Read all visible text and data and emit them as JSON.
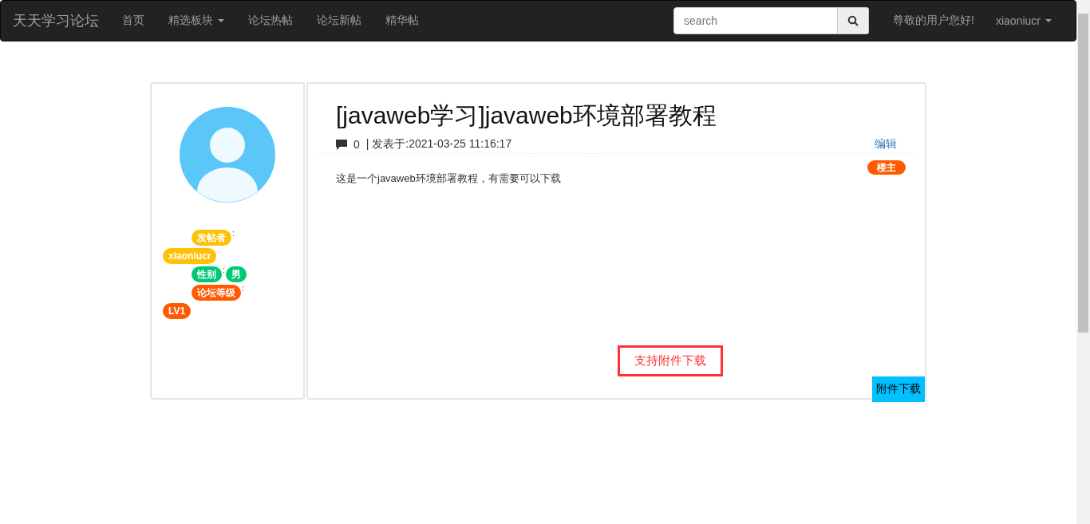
{
  "navbar": {
    "brand": "天天学习论坛",
    "links": [
      {
        "label": "首页",
        "dropdown": false
      },
      {
        "label": "精选板块",
        "dropdown": true
      },
      {
        "label": "论坛热帖",
        "dropdown": false
      },
      {
        "label": "论坛新帖",
        "dropdown": false
      },
      {
        "label": "精华帖",
        "dropdown": false
      }
    ],
    "search": {
      "placeholder": "search"
    },
    "greeting": "尊敬的用户您好!",
    "user": {
      "label": "xiaoniucr",
      "dropdown": true
    }
  },
  "profile": {
    "fields": [
      {
        "kind": "stacked",
        "label": "发帖者",
        "separator": ":",
        "value": "xiaoniucr",
        "color": "#ffc107"
      },
      {
        "kind": "inline",
        "label": "性别",
        "separator": ":",
        "value": "男",
        "color": "#00c875"
      },
      {
        "kind": "stacked",
        "label": "论坛等级",
        "separator": ":",
        "value": "LV1",
        "color": "#ff5a00"
      }
    ]
  },
  "post": {
    "title": "[javaweb学习]javaweb环境部署教程",
    "reply_count": "0",
    "posted": "| 发表于:2021-03-25 11:16:17",
    "edit": "编辑",
    "badge": "楼主",
    "body": "这是一个javaweb环境部署教程，有需要可以下载",
    "attachment_note": "支持附件下载",
    "download": "附件下载"
  }
}
